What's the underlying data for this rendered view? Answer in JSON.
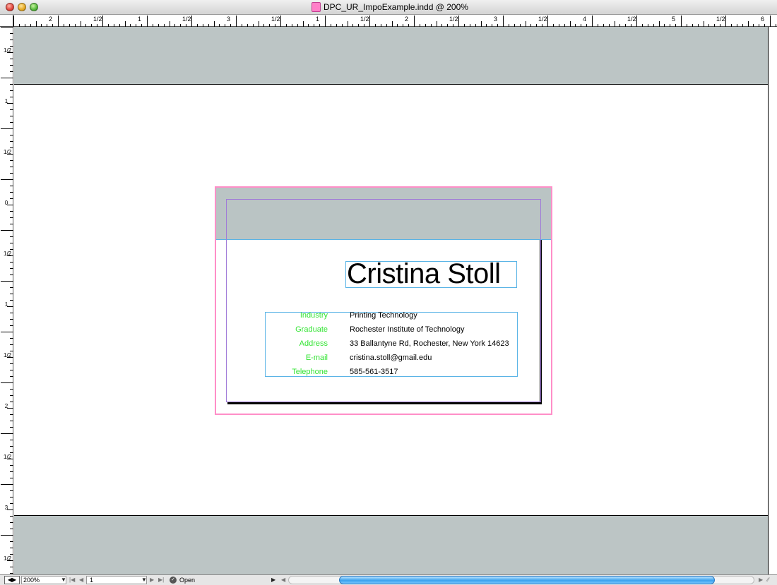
{
  "window": {
    "title": "DPC_UR_ImpoExample.indd @ 200%"
  },
  "ruler": {
    "horizontal_labels": [
      "2",
      "1/2",
      "1",
      "1/2",
      "3",
      "1/2",
      "1",
      "1/2",
      "2",
      "1/2",
      "3",
      "1/2",
      "4",
      "1/2",
      "5",
      "1/2",
      "6"
    ],
    "vertical_labels": [
      "1/2",
      "1",
      "1/2",
      "0",
      "1/2",
      "1",
      "1/2",
      "2",
      "1/2",
      "3",
      "1/2"
    ]
  },
  "card": {
    "name": "Cristina Stoll",
    "fields": [
      {
        "label": "Industry",
        "value": "Printing Technology"
      },
      {
        "label": "Graduate",
        "value": "Rochester Institute of Technology"
      },
      {
        "label": "Address",
        "value": "33 Ballantyne Rd, Rochester, New York 14623"
      },
      {
        "label": "E-mail",
        "value": "cristina.stoll@gmail.edu"
      },
      {
        "label": "Telephone",
        "value": "585-561-3517"
      }
    ],
    "label_color": "#33e433"
  },
  "statusbar": {
    "zoom": "200%",
    "page": "1",
    "document_status": "Open"
  },
  "colors": {
    "pasteboard": "#bcc5c5",
    "bleed_guide": "#ff8fc8",
    "margin_guide": "#a07ad8",
    "frame_edge": "#5ab4e6",
    "scroll_thumb": "#3aa2ee"
  }
}
